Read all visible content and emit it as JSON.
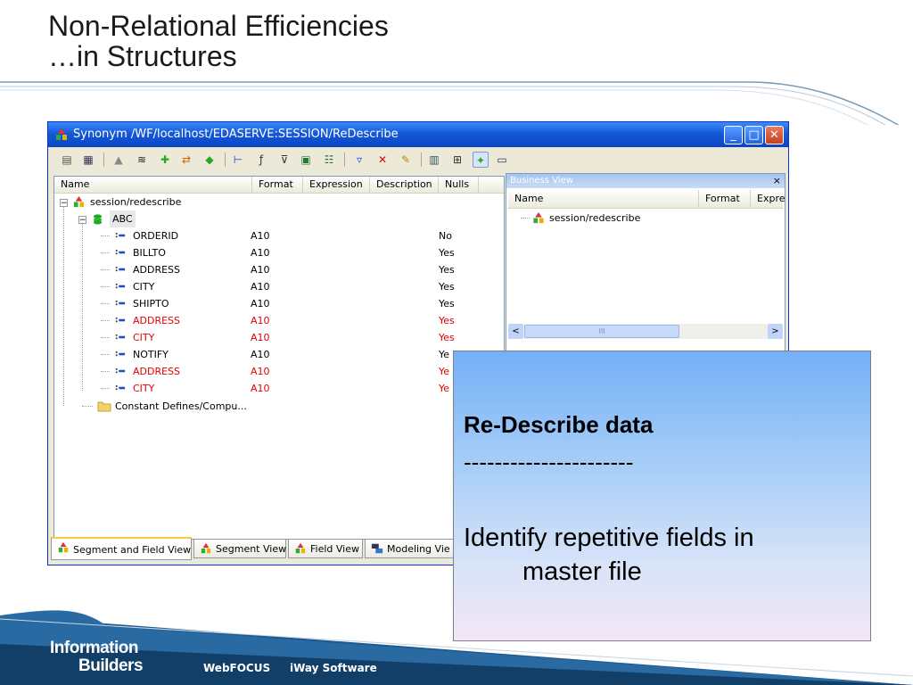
{
  "slide": {
    "title_line1": "Non-Relational Efficiencies",
    "title_line2": "…in Structures"
  },
  "window": {
    "title": "Synonym /WF/localhost/EDASERVE:SESSION/ReDescribe",
    "controls": [
      "minimize",
      "maximize",
      "close"
    ],
    "accent_color": "#0a46c4"
  },
  "grid": {
    "columns": [
      "Name",
      "Format",
      "Expression",
      "Description",
      "Nulls"
    ],
    "root": "session/redescribe",
    "segment": "ABC",
    "fields": [
      {
        "name": "ORDERID",
        "format": "A10",
        "nulls": "No",
        "highlight": false
      },
      {
        "name": "BILLTO",
        "format": "A10",
        "nulls": "Yes",
        "highlight": false
      },
      {
        "name": "ADDRESS",
        "format": "A10",
        "nulls": "Yes",
        "highlight": false
      },
      {
        "name": "CITY",
        "format": "A10",
        "nulls": "Yes",
        "highlight": false
      },
      {
        "name": "SHIPTO",
        "format": "A10",
        "nulls": "Yes",
        "highlight": false
      },
      {
        "name": "ADDRESS",
        "format": "A10",
        "nulls": "Yes",
        "highlight": true
      },
      {
        "name": "CITY",
        "format": "A10",
        "nulls": "Yes",
        "highlight": true
      },
      {
        "name": "NOTIFY",
        "format": "A10",
        "nulls": "Ye",
        "highlight": false
      },
      {
        "name": "ADDRESS",
        "format": "A10",
        "nulls": "Ye",
        "highlight": true
      },
      {
        "name": "CITY",
        "format": "A10",
        "nulls": "Ye",
        "highlight": true
      }
    ],
    "constants": "Constant Defines/Compu...",
    "highlight_color": "#e00000"
  },
  "tabs": [
    "Segment and Field View",
    "Segment View",
    "Field View",
    "Modeling Vie"
  ],
  "business_view": {
    "title": "Business View",
    "close": "×",
    "columns": [
      "Name",
      "Format",
      "Expre"
    ],
    "item": "session/redescribe",
    "scroll_left": "<",
    "scroll_right": ">",
    "scroll_grip": "III"
  },
  "callout": {
    "heading": "Re-Describe data",
    "rule": "----------------------",
    "body_line1": "Identify repetitive fields in",
    "body_line2": "master file"
  },
  "footer": {
    "brand_line1": "Information",
    "brand_line2": "Builders",
    "link1": "WebFOCUS",
    "link2": "iWay Software"
  }
}
